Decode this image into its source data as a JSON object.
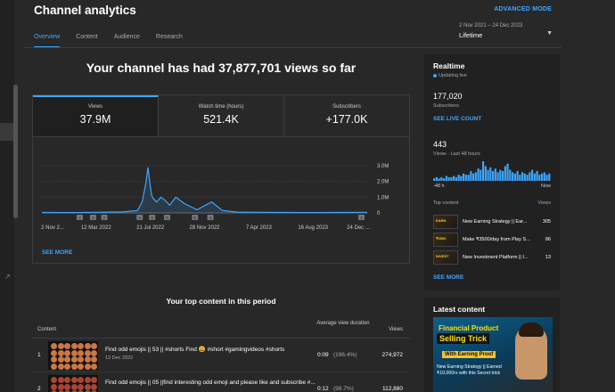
{
  "header": {
    "title": "Channel analytics",
    "advanced_mode": "ADVANCED MODE",
    "tabs": [
      {
        "label": "Overview",
        "active": true
      },
      {
        "label": "Content",
        "active": false
      },
      {
        "label": "Audience",
        "active": false
      },
      {
        "label": "Research",
        "active": false
      }
    ],
    "date_range": "2 Nov 2021 – 24 Dec 2023",
    "period": "Lifetime"
  },
  "overview": {
    "headline": "Your channel has had 37,877,701 views so far",
    "metrics": [
      {
        "label": "Views",
        "value": "37.9M",
        "active": true
      },
      {
        "label": "Watch time (hours)",
        "value": "521.4K",
        "active": false
      },
      {
        "label": "Subscribers",
        "value": "+177.0K",
        "active": false
      }
    ],
    "see_more": "SEE MORE",
    "accent_color": "#3ea6ff"
  },
  "chart_data": {
    "type": "line",
    "y_ticks": [
      "3.0M",
      "2.0M",
      "1.0M",
      "0"
    ],
    "x_ticks": [
      "2 Nov 2...",
      "12 Mar 2022",
      "21 Jul 2022",
      "28 Nov 2022",
      "7 Apr 2023",
      "16 Aug 2023",
      "24 Dec ..."
    ],
    "ylim": [
      0,
      3000000
    ],
    "x": [
      "2021-11-02",
      "2022-01-15",
      "2022-03-12",
      "2022-05-15",
      "2022-06-20",
      "2022-07-01",
      "2022-07-10",
      "2022-07-15",
      "2022-07-20",
      "2022-07-24",
      "2022-07-28",
      "2022-08-05",
      "2022-08-15",
      "2022-08-25",
      "2022-09-05",
      "2022-09-20",
      "2022-10-10",
      "2022-11-10",
      "2022-12-15",
      "2023-01-10",
      "2023-02-15",
      "2023-04-07",
      "2023-06-01",
      "2023-08-16",
      "2023-10-10",
      "2023-12-24"
    ],
    "values": [
      30000,
      20000,
      40000,
      60000,
      150000,
      700000,
      1900000,
      2900000,
      1800000,
      1100000,
      900000,
      700000,
      1000000,
      800000,
      500000,
      1000000,
      600000,
      200000,
      700000,
      150000,
      50000,
      40000,
      30000,
      20000,
      30000,
      40000
    ],
    "markers": [
      {
        "x": "2022-02-01",
        "label": "4"
      },
      {
        "x": "2022-03-05",
        "label": "3"
      },
      {
        "x": "2022-04-01",
        "label": "2"
      },
      {
        "x": "2022-06-25",
        "label": "4"
      },
      {
        "x": "2022-07-25",
        "label": "5"
      },
      {
        "x": "2022-08-30",
        "label": "↻"
      },
      {
        "x": "2022-11-05",
        "label": "↻"
      },
      {
        "x": "2022-12-12",
        "label": "4"
      },
      {
        "x": "2023-12-10",
        "label": "2"
      }
    ],
    "grid": true,
    "color": "#3ea6ff"
  },
  "top_content": {
    "title": "Your top content in this period",
    "columns": {
      "content": "Content",
      "avg_duration": "Average view duration",
      "views": "Views"
    },
    "rows": [
      {
        "rank": "1",
        "title": "Find odd emojis || 53 || #shorts Find 😃 #short #gamingvideos #shorts",
        "date": "13 Dec 2022",
        "duration": "0:09",
        "percent": "(196.4%)",
        "views": "274,972"
      },
      {
        "rank": "2",
        "title": "Find odd emojis || 05 ||find interesting odd emoji and please like and subscribe #...",
        "date": "",
        "duration": "0:12",
        "percent": "(98.7%)",
        "views": "112,880"
      }
    ]
  },
  "realtime": {
    "title": "Realtime",
    "status": "Updating live",
    "subscribers": "177,020",
    "subscribers_label": "Subscribers",
    "see_live_count": "SEE LIVE COUNT",
    "views": "443",
    "views_label": "Views · Last 48 hours",
    "axis_start": "-48 h",
    "axis_end": "Now",
    "bars": [
      2,
      3,
      2,
      3,
      2,
      4,
      3,
      3,
      4,
      3,
      5,
      4,
      6,
      5,
      5,
      8,
      6,
      7,
      10,
      9,
      16,
      12,
      9,
      11,
      8,
      10,
      7,
      9,
      8,
      12,
      14,
      9,
      7,
      6,
      8,
      5,
      7,
      6,
      5,
      7,
      9,
      6,
      8,
      5,
      6,
      7,
      5,
      6
    ],
    "top_content_label": "Top content",
    "views_col": "Views",
    "items": [
      {
        "title": "New Earning Strategy || Ear...",
        "views": "305",
        "thumb": "EARN"
      },
      {
        "title": "Make ₹3500/day from Play S...",
        "views": "86",
        "thumb": "₹3500"
      },
      {
        "title": "New Investment Platform || I...",
        "views": "13",
        "thumb": "INVEST"
      }
    ],
    "see_more": "SEE MORE"
  },
  "latest_content": {
    "title": "Latest content",
    "thumb_line1": "Financial Product",
    "thumb_line2": "Selling Trick",
    "thumb_line3": "With Earning Proof",
    "thumb_caption": "New Earning Strategy || Earned ₹10,000rs with this Secret trick"
  }
}
